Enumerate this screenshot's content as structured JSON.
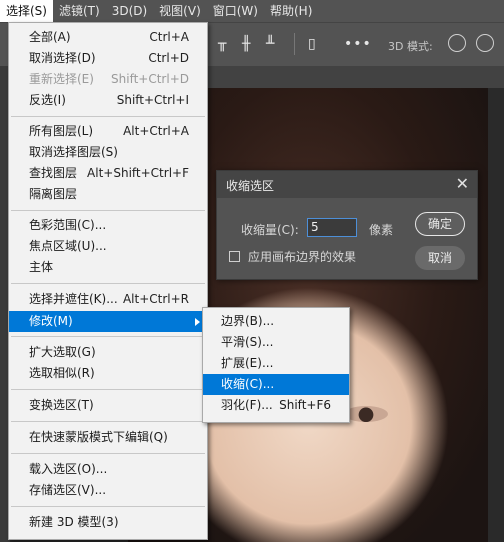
{
  "menubar": {
    "items": [
      {
        "label": "选择(S)"
      },
      {
        "label": "滤镜(T)"
      },
      {
        "label": "3D(D)"
      },
      {
        "label": "视图(V)"
      },
      {
        "label": "窗口(W)"
      },
      {
        "label": "帮助(H)"
      }
    ]
  },
  "options_bar": {
    "mode_label": "3D 模式:"
  },
  "select_menu": {
    "items": [
      {
        "label": "全部(A)",
        "shortcut": "Ctrl+A"
      },
      {
        "label": "取消选择(D)",
        "shortcut": "Ctrl+D"
      },
      {
        "label": "重新选择(E)",
        "shortcut": "Shift+Ctrl+D"
      },
      {
        "label": "反选(I)",
        "shortcut": "Shift+Ctrl+I"
      },
      {
        "label": "所有图层(L)",
        "shortcut": "Alt+Ctrl+A"
      },
      {
        "label": "取消选择图层(S)",
        "shortcut": ""
      },
      {
        "label": "查找图层",
        "shortcut": "Alt+Shift+Ctrl+F"
      },
      {
        "label": "隔离图层",
        "shortcut": ""
      },
      {
        "label": "色彩范围(C)...",
        "shortcut": ""
      },
      {
        "label": "焦点区域(U)...",
        "shortcut": ""
      },
      {
        "label": "主体",
        "shortcut": ""
      },
      {
        "label": "选择并遮住(K)...",
        "shortcut": "Alt+Ctrl+R"
      },
      {
        "label": "修改(M)",
        "shortcut": ""
      },
      {
        "label": "扩大选取(G)",
        "shortcut": ""
      },
      {
        "label": "选取相似(R)",
        "shortcut": ""
      },
      {
        "label": "变换选区(T)",
        "shortcut": ""
      },
      {
        "label": "在快速蒙版模式下编辑(Q)",
        "shortcut": ""
      },
      {
        "label": "载入选区(O)...",
        "shortcut": ""
      },
      {
        "label": "存储选区(V)...",
        "shortcut": ""
      },
      {
        "label": "新建 3D 模型(3)",
        "shortcut": ""
      }
    ]
  },
  "modify_submenu": {
    "items": [
      {
        "label": "边界(B)...",
        "shortcut": ""
      },
      {
        "label": "平滑(S)...",
        "shortcut": ""
      },
      {
        "label": "扩展(E)...",
        "shortcut": ""
      },
      {
        "label": "收缩(C)...",
        "shortcut": ""
      },
      {
        "label": "羽化(F)...",
        "shortcut": "Shift+F6"
      }
    ]
  },
  "contract_dialog": {
    "title": "收缩选区",
    "amount_label": "收缩量(C):",
    "amount_value": "5",
    "unit": "像素",
    "apply_canvas_bounds_label": "应用画布边界的效果",
    "apply_canvas_bounds_checked": false,
    "ok_label": "确定",
    "cancel_label": "取消"
  },
  "colors": {
    "highlight": "#0078d7",
    "menu_bg": "#f2f2f2",
    "chrome": "#535353"
  }
}
